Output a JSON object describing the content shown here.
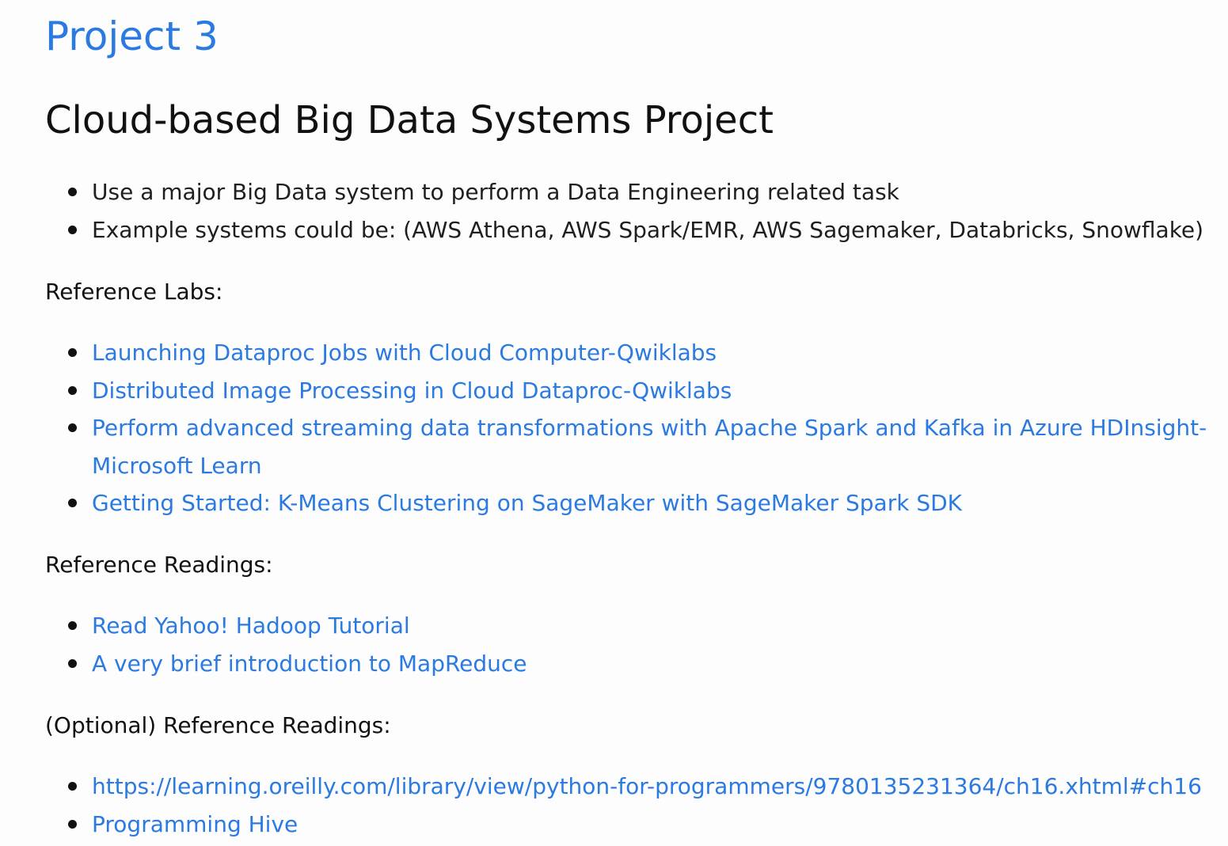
{
  "project_link": "Project 3",
  "heading": "Cloud-based Big Data Systems Project",
  "intro_items": [
    "Use a major Big Data system to perform a Data Engineering related task",
    "Example systems could be: (AWS Athena, AWS Spark/EMR, AWS Sagemaker, Databricks, Snowflake)"
  ],
  "labs_label": "Reference Labs:",
  "labs": [
    "Launching Dataproc Jobs with Cloud Computer-Qwiklabs",
    "Distributed Image Processing in Cloud Dataproc-Qwiklabs",
    "Perform advanced streaming data transformations with Apache Spark and Kafka in Azure HDInsight-Microsoft Learn",
    "Getting Started: K-Means Clustering on SageMaker with SageMaker Spark SDK"
  ],
  "readings_label": "Reference Readings:",
  "readings": [
    "Read Yahoo! Hadoop Tutorial",
    "A very brief introduction to MapReduce"
  ],
  "optional_label": "(Optional) Reference Readings:",
  "optional_readings": [
    "https://learning.oreilly.com/library/view/python-for-programmers/9780135231364/ch16.xhtml#ch16",
    "Programming Hive"
  ]
}
